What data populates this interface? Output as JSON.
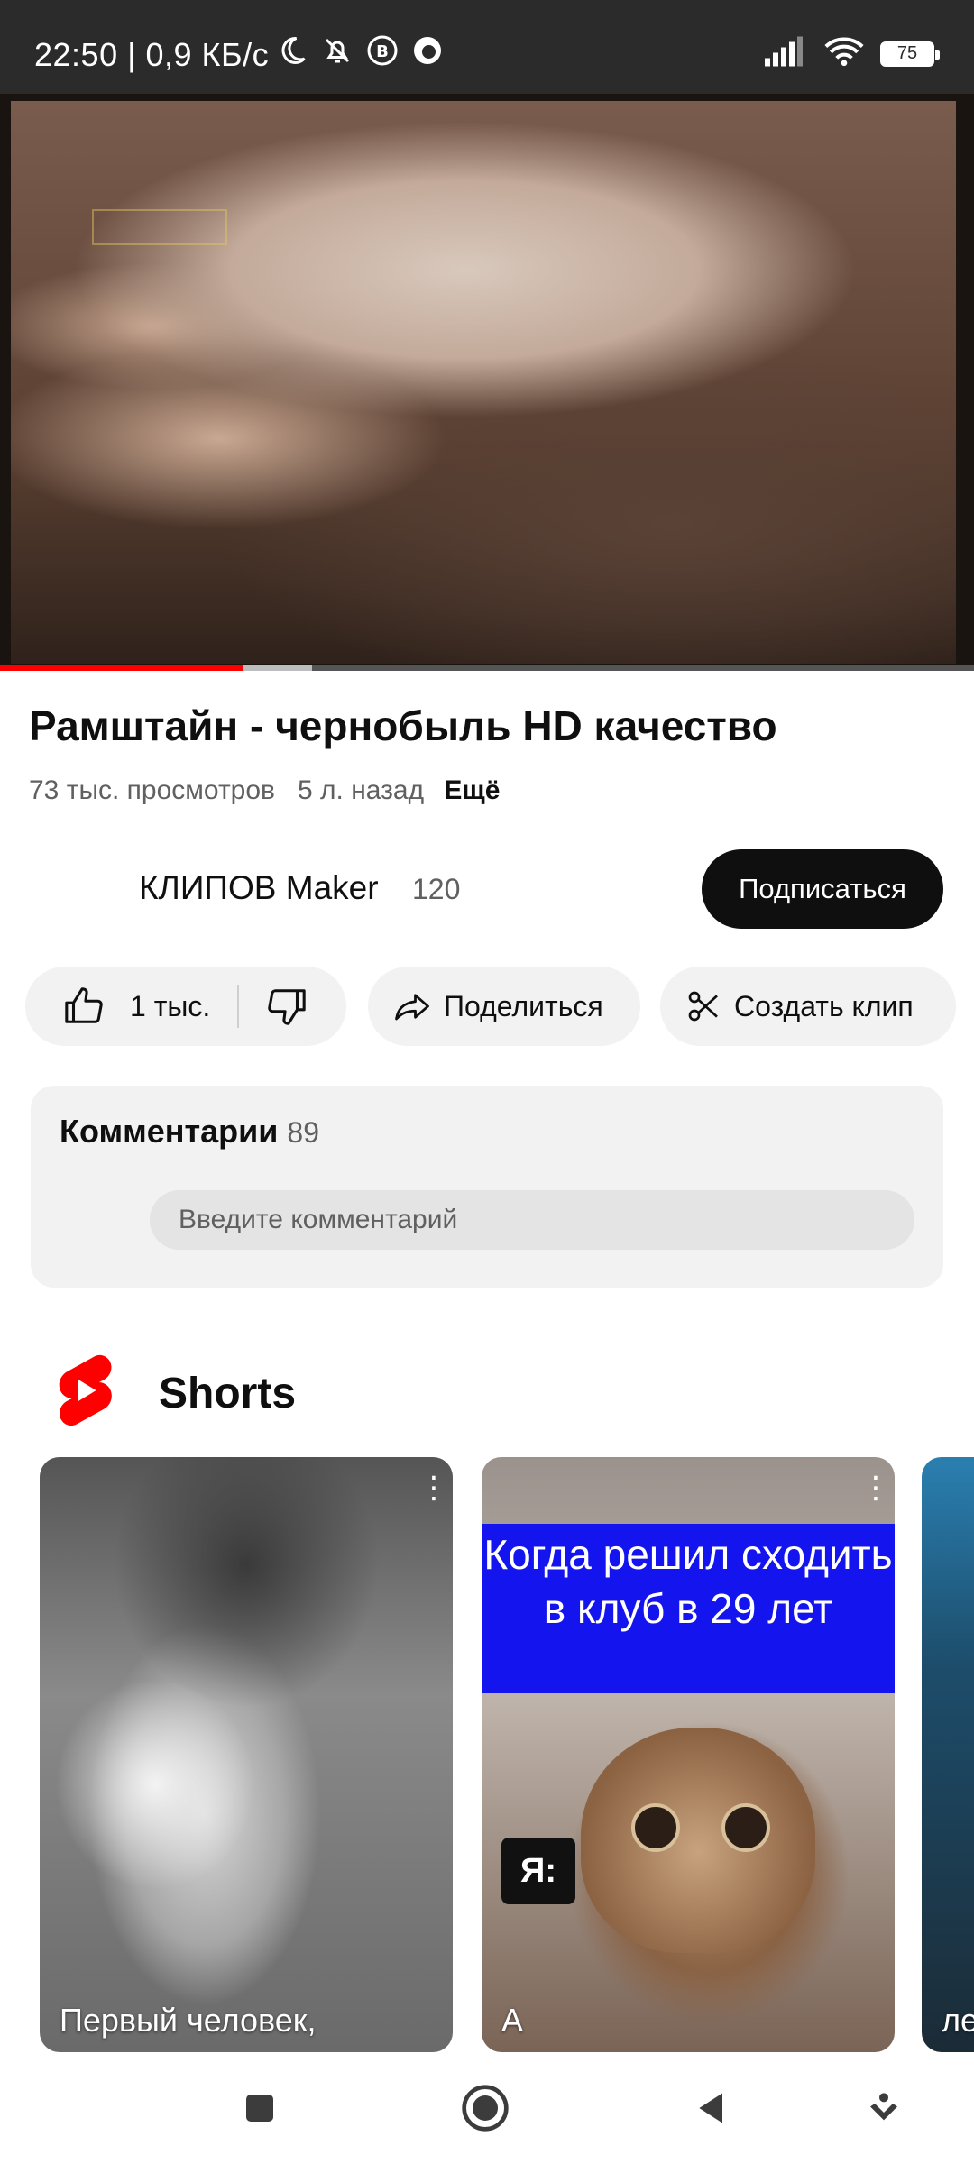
{
  "status_bar": {
    "time": "22:50",
    "speed": "| 0,9 КБ/с",
    "battery": "75",
    "icons_left": [
      "moon-icon",
      "bell-off-icon",
      "b-circle-icon",
      "browser-icon"
    ],
    "icons_right": [
      "signal-icon",
      "wifi-icon",
      "battery-icon"
    ]
  },
  "video": {
    "progress_played": 0.25,
    "progress_buffered": 0.32,
    "progress_color": "#ff0000"
  },
  "title": "Рамштайн - чернобыль HD качество",
  "meta": {
    "views": "73 тыс. просмотров",
    "age": "5 л. назад",
    "more": "Ещё"
  },
  "channel": {
    "name": "КЛИПОВ Maker",
    "subscribers": "120",
    "subscribe_label": "Подписаться"
  },
  "actions": {
    "likes": "1 тыс.",
    "share": "Поделиться",
    "clip": "Создать клип"
  },
  "comments": {
    "header": "Комментарии",
    "count": "89",
    "placeholder": "Введите комментарий"
  },
  "shorts": {
    "section_title": "Shorts",
    "accent": "#ff0000",
    "items": [
      {
        "caption": "Первый человек,"
      },
      {
        "banner": "Когда решил сходить в клуб в 29 лет",
        "badge": "Я:",
        "caption": "А"
      },
      {
        "caption": "ле"
      }
    ]
  },
  "navbar": {
    "buttons": [
      "recents-button",
      "home-button",
      "back-button",
      "assist-button"
    ]
  }
}
